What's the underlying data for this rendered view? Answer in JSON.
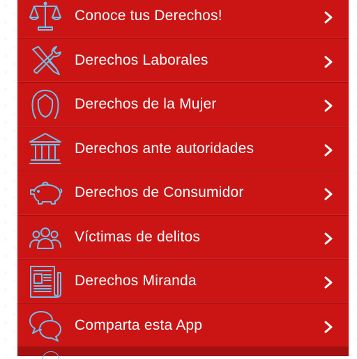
{
  "menu": {
    "items": [
      {
        "label": "Conoce tus Derechos!",
        "icon": "scales-icon"
      },
      {
        "label": "Derechos Laborales",
        "icon": "tools-icon"
      },
      {
        "label": "Derechos de la Mujer",
        "icon": "woman-icon"
      },
      {
        "label": "Derechos ante autoridades",
        "icon": "courthouse-icon"
      },
      {
        "label": "Derechos de Consumidor",
        "icon": "piggy-bank-icon"
      },
      {
        "label": "Víctimas de delitos",
        "icon": "group-icon"
      },
      {
        "label": "Derechos Miranda",
        "icon": "newspaper-icon"
      },
      {
        "label": "Comparta esta App",
        "icon": "chat-bubbles-icon"
      }
    ]
  },
  "colors": {
    "menu_bg": "#cb1414",
    "icon_stroke": "#6fc2ec",
    "text": "#ffffff"
  }
}
